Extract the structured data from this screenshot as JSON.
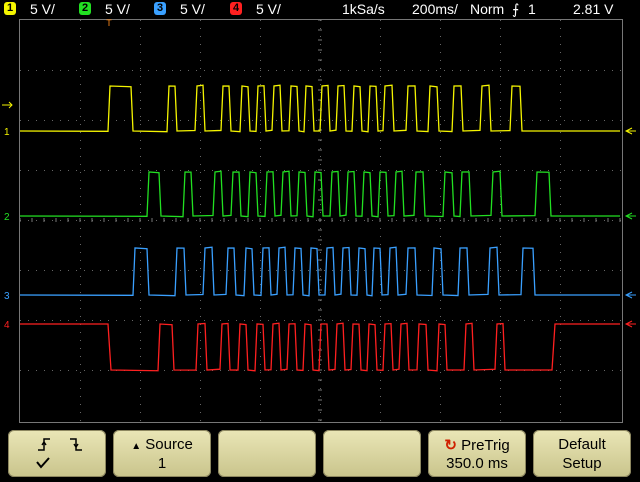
{
  "status_bar": {
    "channels": [
      {
        "num": "1",
        "scale": "5 V/",
        "color": "#f5f500"
      },
      {
        "num": "2",
        "scale": "5 V/",
        "color": "#22e022"
      },
      {
        "num": "3",
        "scale": "5 V/",
        "color": "#3aa0ff"
      },
      {
        "num": "4",
        "scale": "5 V/",
        "color": "#ff2020"
      }
    ],
    "sample_rate": "1kSa/s",
    "timebase": "200ms/",
    "mode": "Norm",
    "trigger_source": "1",
    "trigger_level": "2.81 V"
  },
  "trigger_position_marker": "T",
  "traces": [
    {
      "channel": "1",
      "label": "1",
      "color": "#f5f500"
    },
    {
      "channel": "2",
      "label": "2",
      "color": "#22e022"
    },
    {
      "channel": "3",
      "label": "3",
      "color": "#3aa0ff"
    },
    {
      "channel": "4",
      "label": "4",
      "color": "#ff2020"
    }
  ],
  "softkeys": {
    "slope": {
      "rising": "rising-edge-icon",
      "falling": "falling-edge-icon",
      "selected": "check-icon"
    },
    "source": {
      "label": "Source",
      "value": "1"
    },
    "pretrig": {
      "label": "PreTrig",
      "value": "350.0 ms"
    },
    "default_setup": {
      "line1": "Default",
      "line2": "Setup"
    }
  }
}
